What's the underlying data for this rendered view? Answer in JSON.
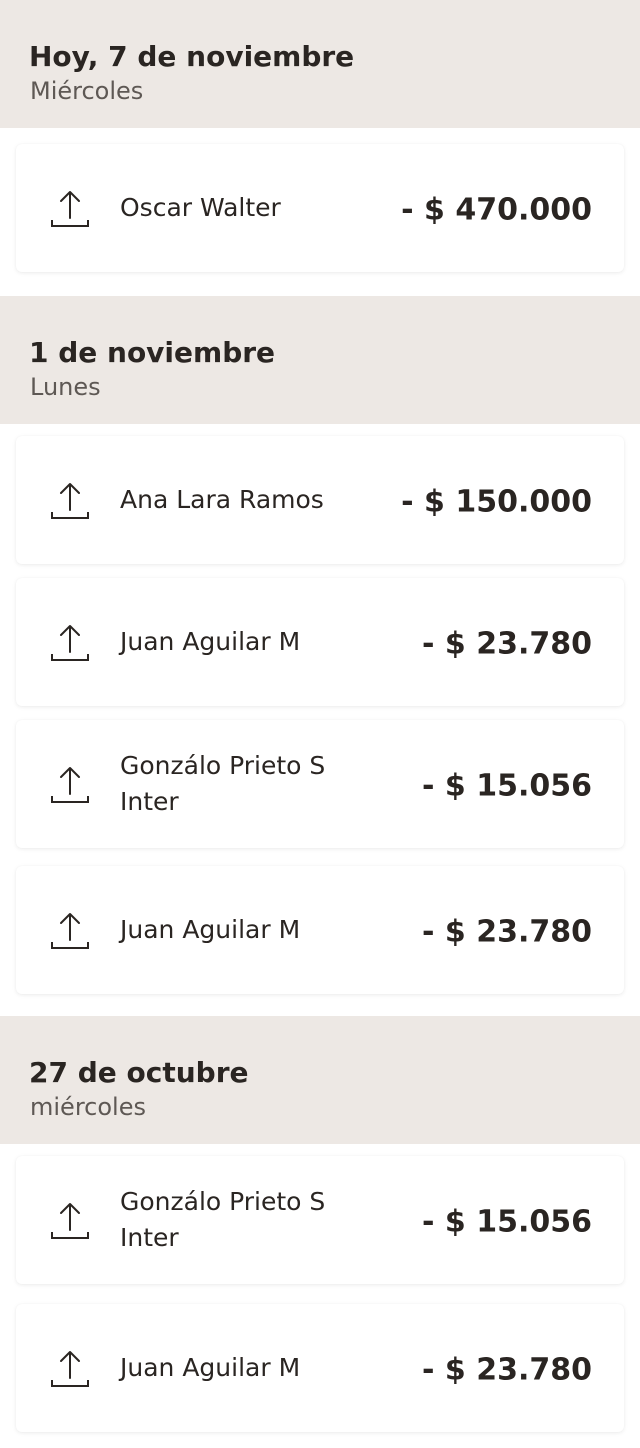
{
  "sections": [
    {
      "title": "Hoy, 7 de noviembre",
      "subtitle": "Miércoles",
      "transactions": [
        {
          "name": "Oscar Walter",
          "amount": "- $ 470.000",
          "icon": "upload-icon"
        }
      ]
    },
    {
      "title": "1 de noviembre",
      "subtitle": "Lunes",
      "transactions": [
        {
          "name": "Ana Lara Ramos",
          "amount": "- $ 150.000",
          "icon": "upload-icon"
        },
        {
          "name": "Juan Aguilar M",
          "amount": "- $ 23.780",
          "icon": "upload-icon"
        },
        {
          "name": "Gonzálo Prieto S Inter",
          "amount": "- $ 15.056",
          "icon": "upload-icon"
        },
        {
          "name": "Juan Aguilar M",
          "amount": "- $ 23.780",
          "icon": "upload-icon"
        }
      ]
    },
    {
      "title": "27 de octubre",
      "subtitle": "miércoles",
      "transactions": [
        {
          "name": "Gonzálo Prieto S Inter",
          "amount": "- $ 15.056",
          "icon": "upload-icon"
        },
        {
          "name": "Juan Aguilar M",
          "amount": "- $ 23.780",
          "icon": "upload-icon"
        }
      ]
    }
  ],
  "colors": {
    "header_background": "#ede8e4",
    "card_background": "#ffffff",
    "text_primary": "#2a2522",
    "text_secondary": "#5e5854"
  }
}
